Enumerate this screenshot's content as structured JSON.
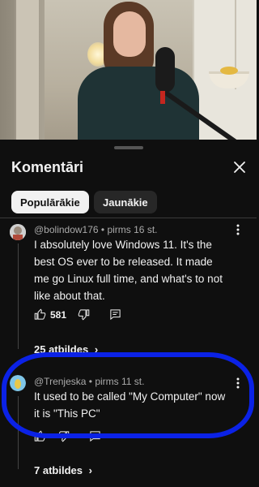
{
  "sheet": {
    "title": "Komentāri"
  },
  "tabs": [
    {
      "label": "Populārākie",
      "active": true
    },
    {
      "label": "Jaunākie",
      "active": false
    }
  ],
  "comments": [
    {
      "author": "@bolindow176",
      "separator": "•",
      "time": "pirms 16 st.",
      "text": "I absolutely love Windows 11. It's the best OS ever to be released. It made me go Linux full time, and what's to not like about that.",
      "likes": "581",
      "replies": "25 atbildes"
    },
    {
      "author": "@Trenjeska",
      "separator": "•",
      "time": "pirms 11 st.",
      "text": "It used to be called \"My Computer\" now it is \"This PC\"",
      "replies": "7 atbildes"
    }
  ],
  "colors": {
    "highlight": "#0b22e6",
    "background": "#0f0f0f"
  },
  "icons": [
    "close-icon",
    "more-vert-icon",
    "thumb-up-icon",
    "thumb-down-icon",
    "reply-icon",
    "chevron-right-icon"
  ]
}
